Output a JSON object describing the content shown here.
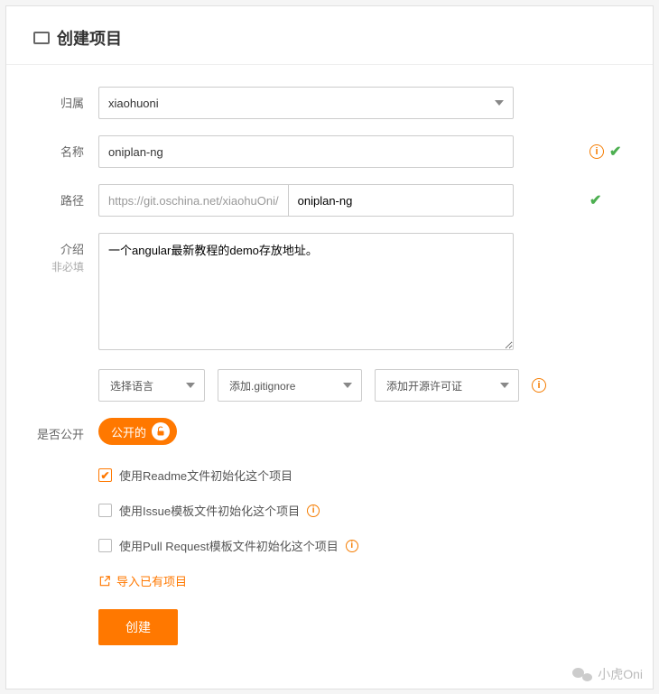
{
  "header": {
    "title": "创建项目"
  },
  "labels": {
    "owner": "归属",
    "name": "名称",
    "path": "路径",
    "intro": "介绍",
    "intro_optional": "非必填",
    "public": "是否公开"
  },
  "fields": {
    "owner_value": "xiaohuoni",
    "name_value": "oniplan-ng",
    "path_prefix": "https://git.oschina.net/xiaohuOni/",
    "path_value": "oniplan-ng",
    "intro_value": "一个angular最新教程的demo存放地址。"
  },
  "selects": {
    "language": "选择语言",
    "gitignore": "添加.gitignore",
    "license": "添加开源许可证"
  },
  "toggle": {
    "public_label": "公开的"
  },
  "checks": {
    "readme": "使用Readme文件初始化这个项目",
    "issue": "使用Issue模板文件初始化这个项目",
    "pr": "使用Pull Request模板文件初始化这个项目"
  },
  "actions": {
    "import": "导入已有项目",
    "submit": "创建"
  },
  "watermark": {
    "text": "小虎Oni"
  }
}
